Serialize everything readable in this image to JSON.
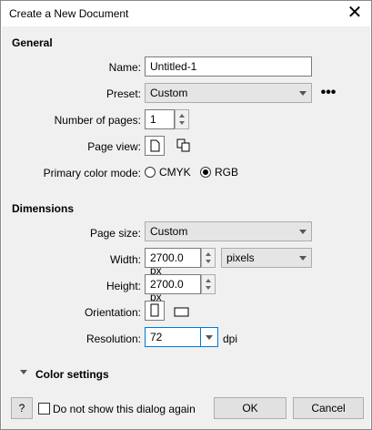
{
  "dialog": {
    "title": "Create a New Document"
  },
  "general": {
    "heading": "General",
    "name_label": "Name:",
    "name_value": "Untitled-1",
    "preset_label": "Preset:",
    "preset_value": "Custom",
    "more_icon": "more-dots-icon",
    "pages_label": "Number of pages:",
    "pages_value": "1",
    "page_view_label": "Page view:",
    "color_mode_label": "Primary color mode:",
    "color_modes": [
      "CMYK",
      "RGB"
    ],
    "selected_color_mode": "RGB"
  },
  "dimensions": {
    "heading": "Dimensions",
    "page_size_label": "Page size:",
    "page_size_value": "Custom",
    "width_label": "Width:",
    "width_value": "2700.0 px",
    "units_value": "pixels",
    "height_label": "Height:",
    "height_value": "2700.0 px",
    "orientation_label": "Orientation:",
    "resolution_label": "Resolution:",
    "resolution_value": "72",
    "resolution_unit": "dpi"
  },
  "color_settings": {
    "label": "Color settings"
  },
  "footer": {
    "help_label": "?",
    "dont_show_label": "Do not show this dialog again",
    "ok_label": "OK",
    "cancel_label": "Cancel"
  }
}
